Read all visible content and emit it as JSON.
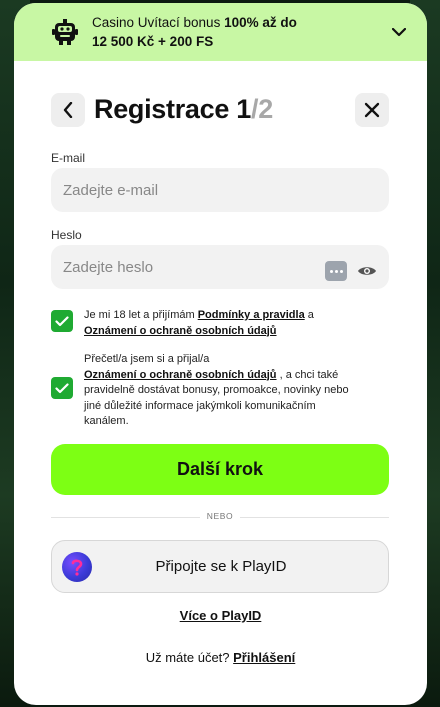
{
  "banner": {
    "text_prefix": "Casino Uvítací bonus ",
    "text_bold": "100% až do",
    "text_line2": "12 500 Kč + 200 FS"
  },
  "header": {
    "title": "Registrace 1",
    "step_total": "/2"
  },
  "email": {
    "label": "E-mail",
    "placeholder": "Zadejte e-mail"
  },
  "password": {
    "label": "Heslo",
    "placeholder": "Zadejte heslo"
  },
  "consents": [
    {
      "text_before": "Je mi 18 let a přijímám ",
      "link1": "Podmínky a pravidla",
      "text_middle": " a",
      "link2": "Oznámení o ochraně osobních údajů",
      "checked": true
    },
    {
      "text_before": "Přečetl/a jsem si a přijal/a",
      "link1": "Oznámení o ochraně osobních údajů",
      "text_after": " , a chci také pravidelně dostávat bonusy, promoakce, novinky nebo jiné důležité informace jakýmkoli komunikačním kanálem.",
      "checked": true
    }
  ],
  "primary_button": "Další krok",
  "divider_label": "NEBO",
  "playid_button": "Připojte se k PlayID",
  "more_playid": "Více o PlayID",
  "login": {
    "question": "Už máte účet? ",
    "link": "Přihlášení"
  },
  "colors": {
    "banner_bg": "#c8f7a4",
    "primary": "#7dff14",
    "checkbox": "#1faa32"
  }
}
